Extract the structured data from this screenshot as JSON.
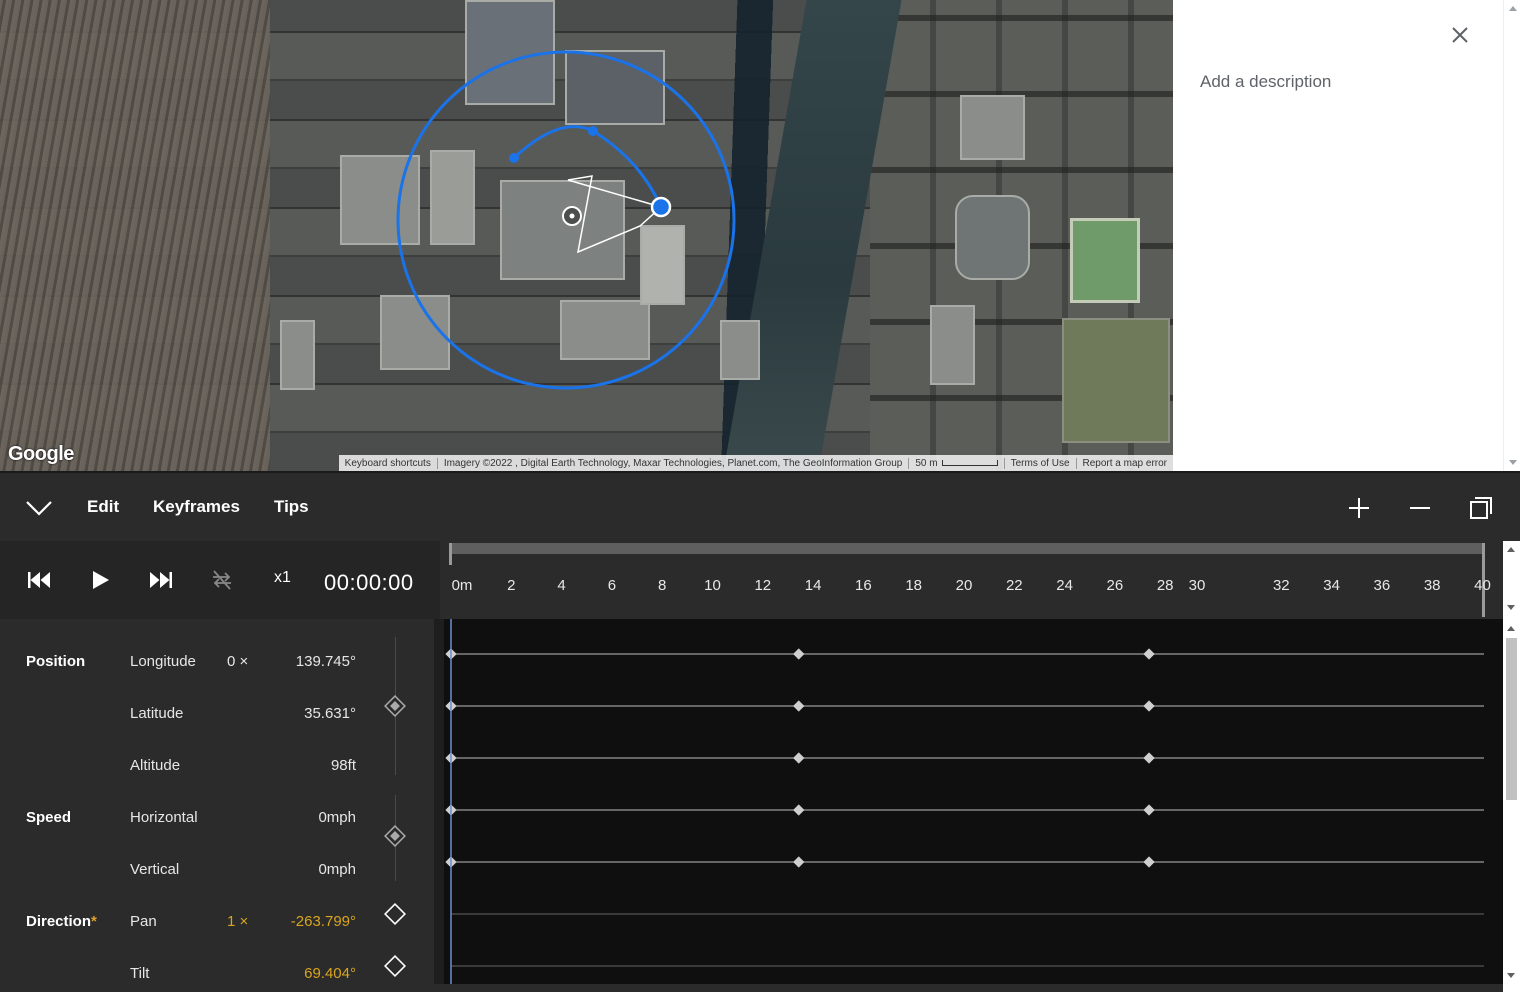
{
  "map": {
    "logo": "Google",
    "attribution": {
      "shortcuts": "Keyboard shortcuts",
      "imagery": "Imagery ©2022 , Digital Earth Technology, Maxar Technologies, Planet.com, The GeoInformation Group",
      "scale": "50 m",
      "terms": "Terms of Use",
      "report": "Report a map error"
    },
    "orbit_color": "#1a73e8"
  },
  "description_panel": {
    "placeholder": "Add a description",
    "close_icon": "close-icon"
  },
  "menubar": {
    "items": [
      "Edit",
      "Keyframes",
      "Tips"
    ],
    "icons": [
      "chevron-down-icon",
      "zoom-in-icon",
      "zoom-out-icon",
      "fit-icon"
    ]
  },
  "transport": {
    "speed": "x1",
    "timecode": "00:00:00",
    "icons": [
      "skip-to-start-icon",
      "play-icon",
      "skip-to-end-icon",
      "loop-off-icon"
    ]
  },
  "ruler": {
    "ticks": [
      "0m",
      "2",
      "4",
      "6",
      "8",
      "10",
      "12",
      "14",
      "16",
      "18",
      "20",
      "22",
      "24",
      "26",
      "28",
      "30",
      "32",
      "34",
      "36",
      "38",
      "40"
    ]
  },
  "properties": [
    {
      "group": "Position",
      "name": "Longitude",
      "multiplier": "0 ×",
      "value": "139.745°",
      "amber": false
    },
    {
      "group": "",
      "name": "Latitude",
      "multiplier": "",
      "value": "35.631°",
      "amber": false
    },
    {
      "group": "",
      "name": "Altitude",
      "multiplier": "",
      "value": "98ft",
      "amber": false
    },
    {
      "group": "Speed",
      "name": "Horizontal",
      "multiplier": "",
      "value": "0mph",
      "amber": false
    },
    {
      "group": "",
      "name": "Vertical",
      "multiplier": "",
      "value": "0mph",
      "amber": false
    },
    {
      "group": "Direction",
      "group_marker": "*",
      "name": "Pan",
      "multiplier": "1 ×",
      "value": "-263.799°",
      "amber": true
    },
    {
      "group": "",
      "name": "Tilt",
      "multiplier": "",
      "value": "69.404°",
      "amber": true
    }
  ],
  "tracks": {
    "keyframe_times": [
      0,
      13.6,
      27.3
    ],
    "tracks_with_keyframes": 5,
    "total_tracks": 7,
    "timeline_max": 40.4
  },
  "colors": {
    "accent_amber": "#d9a520",
    "panel_bg": "#2b2b2b",
    "track_bg": "#0f0f0f"
  }
}
